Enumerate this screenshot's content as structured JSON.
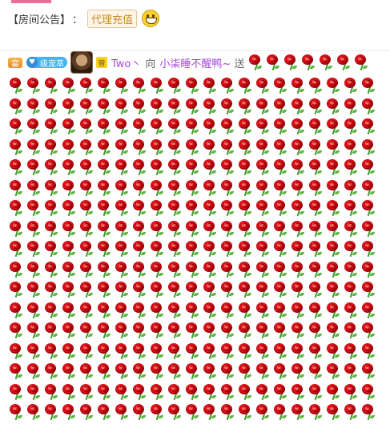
{
  "announcement": {
    "label": "【房间公告】",
    "colon": "：",
    "tag": "代理充值"
  },
  "message": {
    "rich_badge": "富",
    "level_badge": "级宠萃",
    "admin_badge": "管",
    "sender": "Two丶",
    "verb": "向",
    "target": "小柒睡不醒鸭~",
    "send": "送"
  },
  "gift": {
    "icon": "rose-icon",
    "inline_count": 7,
    "grid_rows": 17,
    "grid_cols": 21
  },
  "colors": {
    "accent": "#f06a9a",
    "name": "#a347d8",
    "rose": "#d80f16"
  }
}
